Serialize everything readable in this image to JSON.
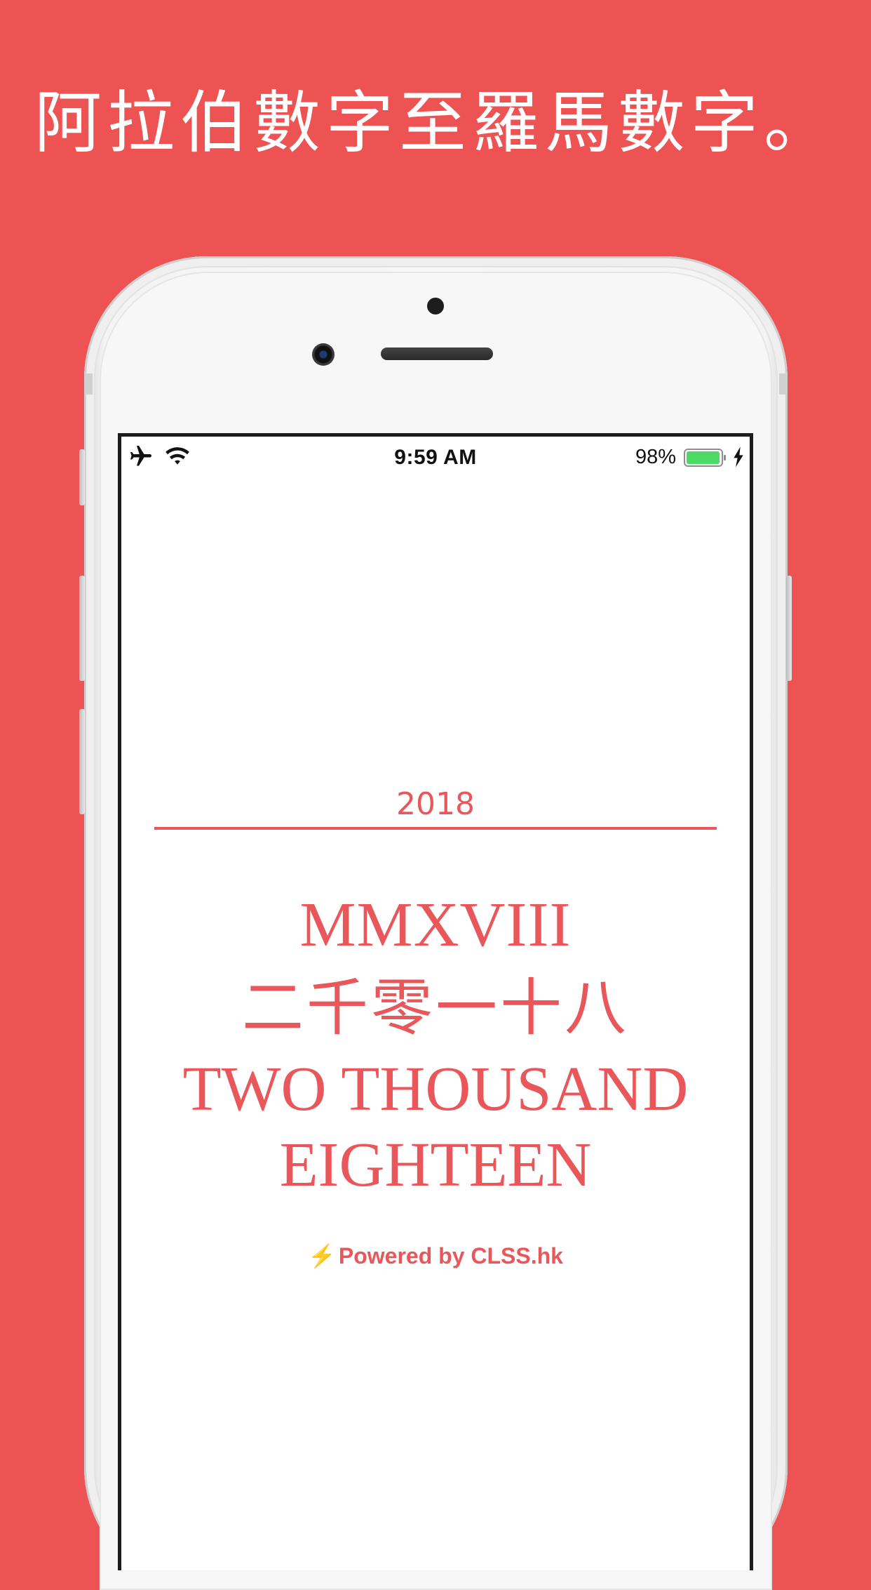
{
  "headline": "阿拉伯數字至羅馬數字。",
  "status_bar": {
    "time": "9:59 AM",
    "battery_percent": "98%",
    "battery_level": 0.98,
    "icons": [
      "airplane-icon",
      "wifi-icon",
      "battery-icon",
      "charging-icon"
    ]
  },
  "converter": {
    "input_value": "2018",
    "roman": "MMXVIII",
    "chinese": "二千零一十八",
    "english_line1": "TWO THOUSAND",
    "english_line2": "EIGHTEEN"
  },
  "footer": {
    "bolt": "⚡",
    "powered_by": "Powered by CLSS.hk"
  },
  "colors": {
    "background": "#EE5354",
    "accent": "#E9575A",
    "battery": "#4CD964",
    "bolt": "#F4C22E"
  }
}
